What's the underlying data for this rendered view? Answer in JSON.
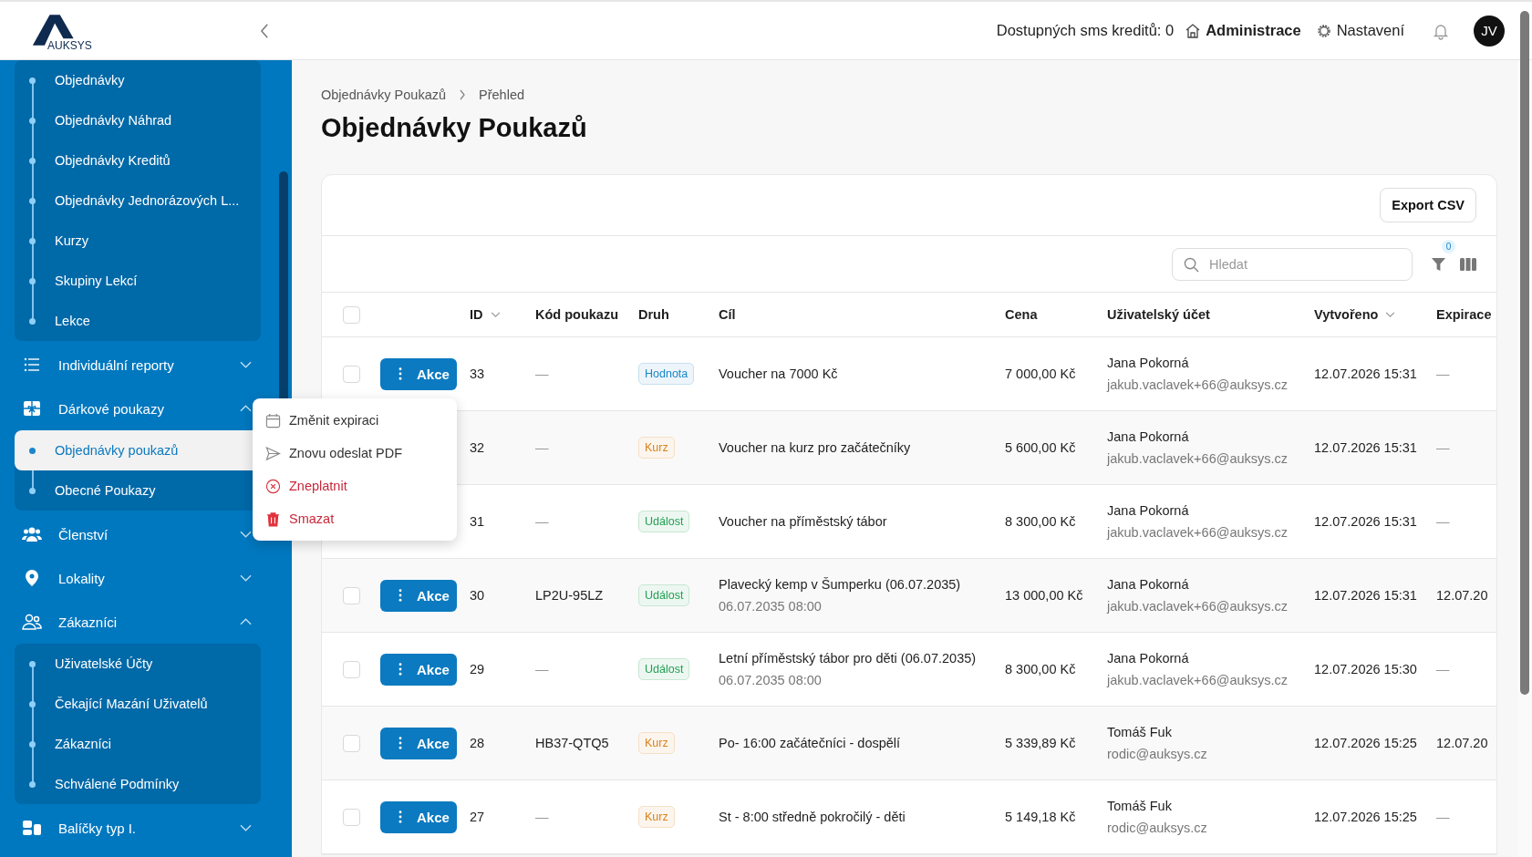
{
  "header": {
    "logo_text": "AUKSYS",
    "sms_credits": "Dostupných sms kreditů: 0",
    "links": [
      {
        "label": "Administrace",
        "bold": true
      },
      {
        "label": "Nastavení",
        "bold": false
      }
    ],
    "avatar": "JV"
  },
  "sidebar": {
    "items": [
      {
        "kind": "sublist",
        "children": [
          {
            "label": "Objednávky",
            "selected": false
          },
          {
            "label": "Objednávky Náhrad",
            "selected": false
          },
          {
            "label": "Objednávky Kreditů",
            "selected": false
          },
          {
            "label": "Objednávky Jednorázových L...",
            "selected": false
          },
          {
            "label": "Kurzy",
            "selected": false
          },
          {
            "label": "Skupiny Lekcí",
            "selected": false
          },
          {
            "label": "Lekce",
            "selected": false
          }
        ]
      },
      {
        "kind": "group",
        "label": "Individuální reporty",
        "expanded": false
      },
      {
        "kind": "group",
        "label": "Dárkové poukazy",
        "expanded": true,
        "children": [
          {
            "label": "Objednávky poukazů",
            "selected": true
          },
          {
            "label": "Obecné Poukazy",
            "selected": false
          }
        ]
      },
      {
        "kind": "group",
        "label": "Členství",
        "expanded": false
      },
      {
        "kind": "group",
        "label": "Lokality",
        "expanded": false
      },
      {
        "kind": "group",
        "label": "Zákazníci",
        "expanded": true,
        "children": [
          {
            "label": "Uživatelské Účty",
            "selected": false
          },
          {
            "label": "Čekající Mazání Uživatelů",
            "selected": false
          },
          {
            "label": "Zákazníci",
            "selected": false
          },
          {
            "label": "Schválené Podmínky",
            "selected": false
          }
        ]
      },
      {
        "kind": "group",
        "label": "Balíčky typ I.",
        "expanded": false
      }
    ]
  },
  "breadcrumb": [
    "Objednávky Poukazů",
    "Přehled"
  ],
  "title": "Objednávky Poukazů",
  "export_button": "Export CSV",
  "search": {
    "placeholder": "Hledat"
  },
  "filter_count": "0",
  "table": {
    "select_all_checked": false,
    "columns": [
      {
        "label": "ID",
        "sortable": true
      },
      {
        "label": "Kód poukazu",
        "sortable": false
      },
      {
        "label": "Druh",
        "sortable": false
      },
      {
        "label": "Cíl",
        "sortable": false
      },
      {
        "label": "Cena",
        "sortable": false
      },
      {
        "label": "Uživatelský účet",
        "sortable": false
      },
      {
        "label": "Vytvořeno",
        "sortable": true
      },
      {
        "label": "Expirace",
        "sortable": false
      }
    ],
    "rows": [
      {
        "checked": false,
        "action": "Akce",
        "id": "33",
        "code": "—",
        "tag": {
          "label": "Hodnota",
          "color": "#1a86c8"
        },
        "target": "Voucher na 7000 Kč",
        "price": "7 000,00 Kč",
        "user_name": "Jana Pokorná",
        "user_email": "jakub.vaclavek+66@auksys.cz",
        "created": "12.07.2026 15:31",
        "expires": "—"
      },
      {
        "id": "32",
        "code": "—",
        "tag": {
          "label": "Kurz",
          "color": "#d9821a"
        },
        "target": "Voucher na kurz pro začátečníky",
        "price": "5 600,00 Kč",
        "user_name": "Jana Pokorná",
        "user_email": "jakub.vaclavek+66@auksys.cz",
        "created": "12.07.2026 15:31",
        "expires": "—"
      },
      {
        "id": "31",
        "code": "—",
        "tag": {
          "label": "Událost",
          "color": "#22a052"
        },
        "target": "Voucher na příměstský tábor",
        "price": "8 300,00 Kč",
        "user_name": "Jana Pokorná",
        "user_email": "jakub.vaclavek+66@auksys.cz",
        "created": "12.07.2026 15:31",
        "expires": "—"
      },
      {
        "checked": false,
        "action": "Akce",
        "id": "30",
        "code": "LP2U-95LZ",
        "tag": {
          "label": "Událost",
          "color": "#22a052"
        },
        "target": "Plavecký kemp v Šumperku (06.07.2035)",
        "target_sub": "06.07.2035 08:00",
        "price": "13 000,00 Kč",
        "user_name": "Jana Pokorná",
        "user_email": "jakub.vaclavek+66@auksys.cz",
        "created": "12.07.2026 15:31",
        "expires": "12.07.20"
      },
      {
        "checked": false,
        "action": "Akce",
        "id": "29",
        "code": "—",
        "tag": {
          "label": "Událost",
          "color": "#22a052"
        },
        "target": "Letní příměstský tábor pro děti (06.07.2035)",
        "target_sub": "06.07.2035 08:00",
        "price": "8 300,00 Kč",
        "user_name": "Jana Pokorná",
        "user_email": "jakub.vaclavek+66@auksys.cz",
        "created": "12.07.2026 15:30",
        "expires": "—"
      },
      {
        "checked": false,
        "action": "Akce",
        "id": "28",
        "code": "HB37-QTQ5",
        "tag": {
          "label": "Kurz",
          "color": "#d9821a"
        },
        "target": "Po- 16:00 začátečníci - dospělí",
        "price": "5 339,89 Kč",
        "user_name": "Tomáš Fuk",
        "user_email": "rodic@auksys.cz",
        "created": "12.07.2026 15:25",
        "expires": "12.07.20"
      },
      {
        "checked": false,
        "action": "Akce",
        "id": "27",
        "code": "—",
        "tag": {
          "label": "Kurz",
          "color": "#d9821a"
        },
        "target": "St - 8:00 středně pokročilý - děti",
        "price": "5 149,18 Kč",
        "user_name": "Tomáš Fuk",
        "user_email": "rodic@auksys.cz",
        "created": "12.07.2026 15:25",
        "expires": "—"
      }
    ]
  },
  "action_menu": {
    "items": [
      {
        "label": "Změnit expiraci",
        "danger": false
      },
      {
        "label": "Znovu odeslat PDF",
        "danger": false
      },
      {
        "label": "Zneplatnit",
        "danger": true
      },
      {
        "label": "Smazat",
        "danger": true
      }
    ]
  }
}
